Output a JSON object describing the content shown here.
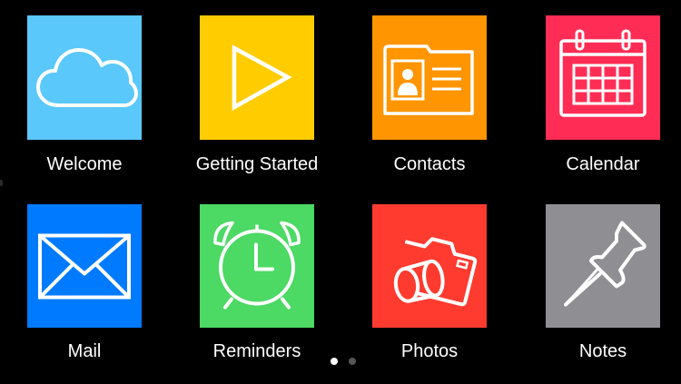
{
  "apps": [
    {
      "id": "welcome",
      "label": "Welcome",
      "color": "#5AC8FA",
      "icon": "cloud-icon"
    },
    {
      "id": "getting-started",
      "label": "Getting Started",
      "color": "#FFCC00",
      "icon": "play-icon"
    },
    {
      "id": "contacts",
      "label": "Contacts",
      "color": "#FF9500",
      "icon": "contact-card-icon"
    },
    {
      "id": "calendar",
      "label": "Calendar",
      "color": "#FF2D55",
      "icon": "calendar-icon"
    },
    {
      "id": "mail",
      "label": "Mail",
      "color": "#007AFF",
      "icon": "envelope-icon"
    },
    {
      "id": "reminders",
      "label": "Reminders",
      "color": "#4CD964",
      "icon": "alarm-clock-icon"
    },
    {
      "id": "photos",
      "label": "Photos",
      "color": "#FF3B30",
      "icon": "camera-icon"
    },
    {
      "id": "notes",
      "label": "Notes",
      "color": "#8E8E93",
      "icon": "pushpin-icon"
    }
  ],
  "pagination": {
    "active_color": "#FFFFFF",
    "inactive_color": "#555555"
  }
}
